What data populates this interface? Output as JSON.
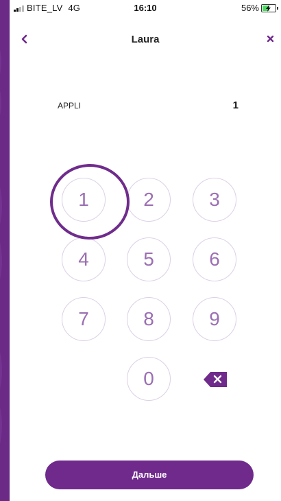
{
  "status_bar": {
    "carrier": "BITE_LV",
    "network": "4G",
    "time": "16:10",
    "battery_percent": "56%",
    "battery_level": 0.56,
    "battery_color": "#4cd964",
    "signal_bars": 2,
    "battery_icon": "battery-charging-icon"
  },
  "header": {
    "title": "Laura",
    "back_icon": "chevron-left-icon",
    "close_icon": "close-icon"
  },
  "entry": {
    "label": "APPLI",
    "value": "1"
  },
  "keypad": {
    "keys": [
      "1",
      "2",
      "3",
      "4",
      "5",
      "6",
      "7",
      "8",
      "9",
      "0"
    ],
    "highlighted_key": "1",
    "backspace_icon": "backspace-icon"
  },
  "footer": {
    "next_label": "Дальше"
  },
  "colors": {
    "accent": "#6f2a8c",
    "key_text": "#9b6fb3",
    "key_border": "#ddd0e6",
    "background": "#6a2a86"
  }
}
